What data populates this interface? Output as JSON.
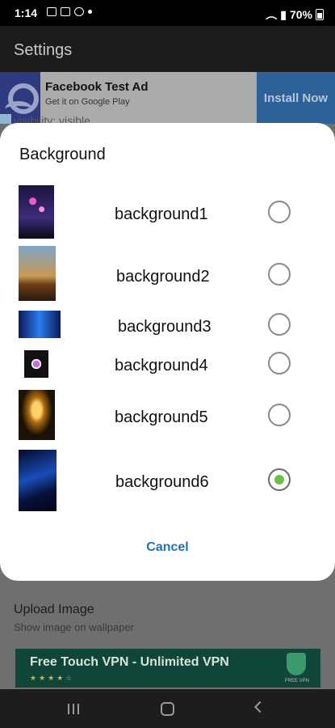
{
  "status_bar": {
    "time": "1:14",
    "battery": "70%"
  },
  "app_bar": {
    "title": "Settings"
  },
  "ad_top": {
    "title": "Facebook Test Ad",
    "subtitle": "Get it on Google Play",
    "cta": "Install Now"
  },
  "behind": {
    "text": "visibility: visible"
  },
  "dialog": {
    "title": "Background",
    "options": [
      {
        "label": "background1",
        "selected": false
      },
      {
        "label": "background2",
        "selected": false
      },
      {
        "label": "background3",
        "selected": false
      },
      {
        "label": "background4",
        "selected": false
      },
      {
        "label": "background5",
        "selected": false
      },
      {
        "label": "background6",
        "selected": true
      }
    ],
    "cancel": "Cancel"
  },
  "settings": {
    "upload_title": "Upload Image",
    "upload_subtitle": "Show image on wallpaper"
  },
  "ad_bottom": {
    "title": "Free Touch VPN - Unlimited VPN",
    "stars": "★★★★☆",
    "badge": "FREE VPN"
  },
  "colors": {
    "accent": "#2a6fb5",
    "radio_selected": "#6cc04a",
    "ad_install": "#2c6199"
  }
}
